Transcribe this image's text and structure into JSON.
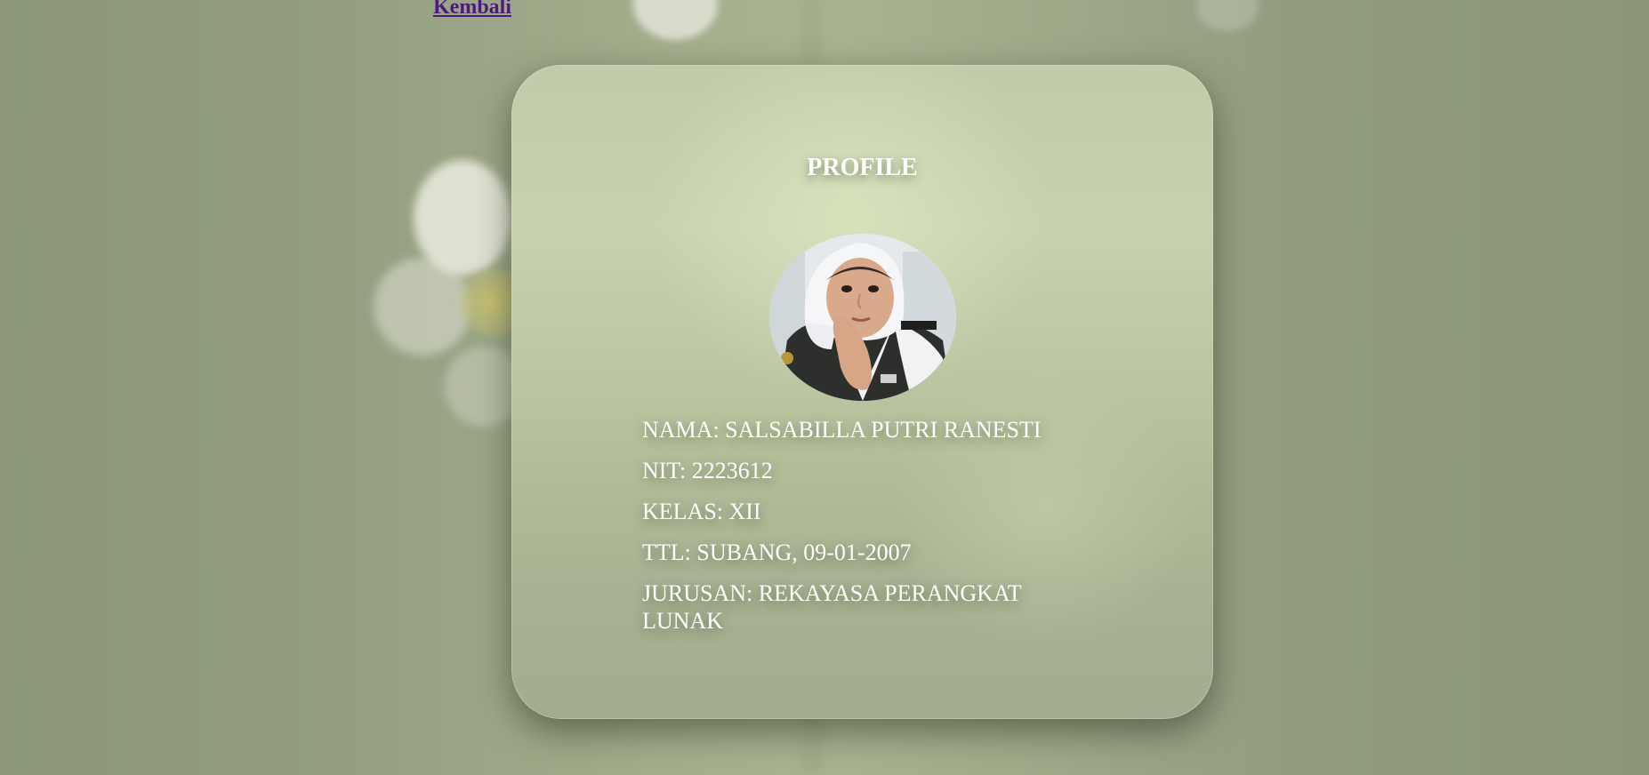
{
  "nav": {
    "back_label": "Kembali"
  },
  "profile": {
    "title": "PROFILE",
    "photo_icon": "avatar-photo",
    "fields": [
      {
        "key": "nama",
        "text": "NAMA: SALSABILLA PUTRI RANESTI"
      },
      {
        "key": "nit",
        "text": "NIT: 2223612"
      },
      {
        "key": "kelas",
        "text": "KELAS: XII"
      },
      {
        "key": "ttl",
        "text": "TTL: SUBANG, 09-01-2007"
      },
      {
        "key": "jurusan",
        "text": "JURUSAN: REKAYASA PERANGKAT LUNAK"
      }
    ]
  },
  "colors": {
    "link": "#4c1b80",
    "text": "#ffffff",
    "background": "#8b9678"
  }
}
